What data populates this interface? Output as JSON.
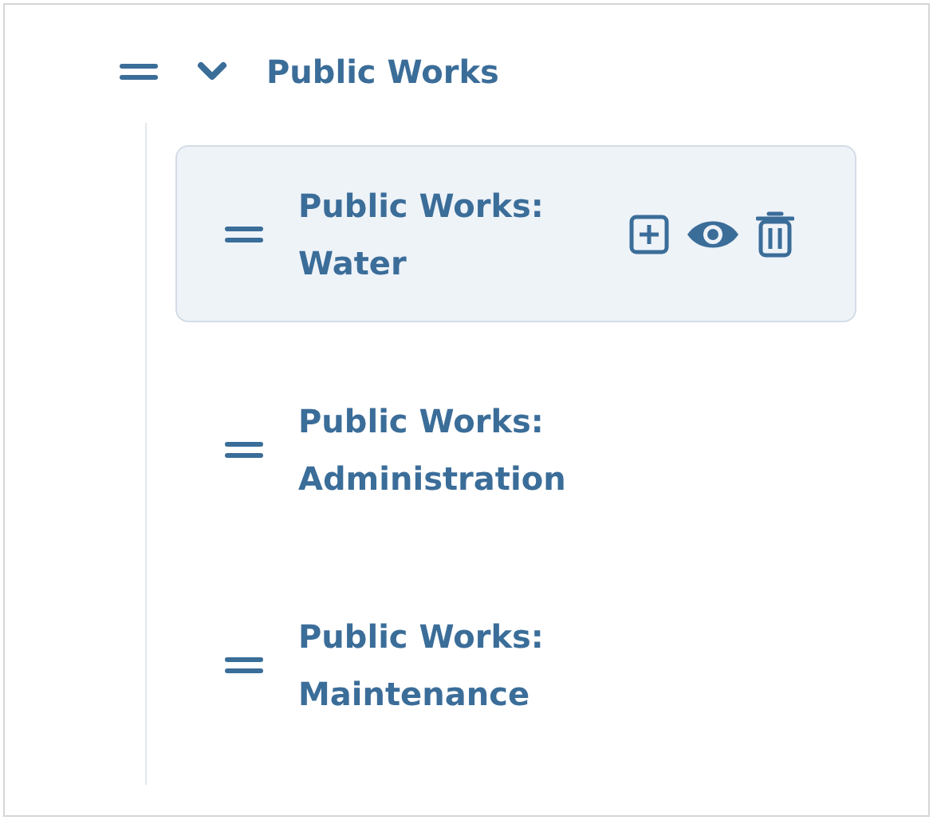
{
  "tree": {
    "label": "Public Works",
    "expanded": true,
    "children": [
      {
        "label": "Public Works: Water",
        "highlighted": true
      },
      {
        "label": "Public Works: Administration",
        "highlighted": false
      },
      {
        "label": "Public Works: Maintenance",
        "highlighted": false
      }
    ]
  }
}
